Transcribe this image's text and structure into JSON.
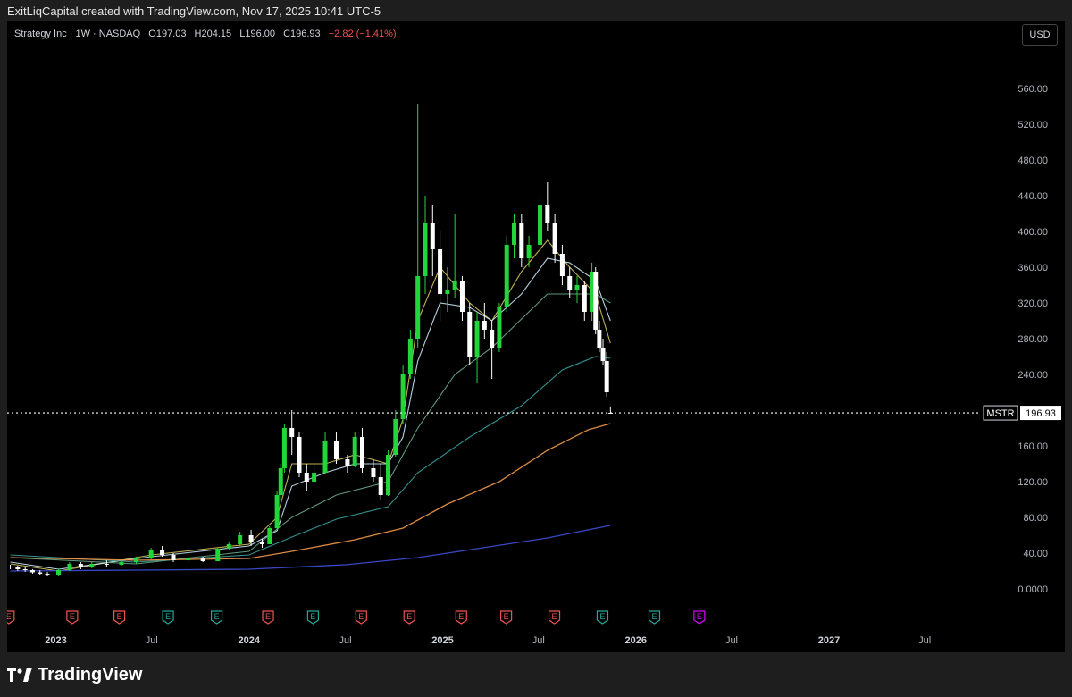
{
  "header": {
    "attribution": "ExitLiqCapital created with TradingView.com, Nov 17, 2025 10:41 UTC-5"
  },
  "legend": {
    "symbol_desc": "Strategy Inc · 1W · NASDAQ",
    "o_label": "O",
    "o_value": "197.03",
    "h_label": "H",
    "h_value": "204.15",
    "l_label": "L",
    "l_value": "196.00",
    "c_label": "C",
    "c_value": "196.93",
    "change": "−2.82 (−1.41%)"
  },
  "currency_button": "USD",
  "price_tag": {
    "ticker": "MSTR",
    "value": "196.93"
  },
  "footer": {
    "brand": "TradingView"
  },
  "colors": {
    "up": "#22d63a",
    "down": "#ffffff",
    "grid": "#000000",
    "ma_fast": "#d4c35c",
    "ma_fast2": "#c9e6f5",
    "ma_mid": "#6aa88a",
    "ma_teal": "#3aa1a0",
    "ma_orange": "#f29a4a",
    "ma_blue": "#3f4fd9",
    "earnings_red": "#ef5350",
    "earnings_green": "#26a69a",
    "earnings_future": "#d500f9"
  },
  "chart_data": {
    "type": "candlestick",
    "title": "Strategy Inc · 1W · NASDAQ",
    "x_ticks": [
      "2023",
      "Jul",
      "2024",
      "Jul",
      "2025",
      "Jul",
      "2026",
      "Jul",
      "2027",
      "Jul"
    ],
    "x_tick_dates": [
      "2023-01-01",
      "2023-07-01",
      "2024-01-01",
      "2024-07-01",
      "2025-01-01",
      "2025-07-01",
      "2026-01-01",
      "2026-07-01",
      "2027-01-01",
      "2027-07-01"
    ],
    "x_range": [
      "2022-10-01",
      "2027-10-15"
    ],
    "y_ticks": [
      "0.0000",
      "40.00",
      "80.00",
      "120.00",
      "160.00",
      "240.00",
      "280.00",
      "320.00",
      "360.00",
      "400.00",
      "440.00",
      "480.00",
      "520.00",
      "560.00"
    ],
    "ylim": [
      -15,
      595
    ],
    "last_close": 196.93,
    "candles": [
      {
        "t": "2022-10-07",
        "o": 25.0,
        "h": 27.0,
        "l": 22.0,
        "c": 24.0
      },
      {
        "t": "2022-10-21",
        "o": 24.0,
        "h": 26.0,
        "l": 20.0,
        "c": 22.0
      },
      {
        "t": "2022-11-04",
        "o": 22.0,
        "h": 24.0,
        "l": 19.0,
        "c": 21.0
      },
      {
        "t": "2022-11-18",
        "o": 21.0,
        "h": 22.0,
        "l": 17.0,
        "c": 18.5
      },
      {
        "t": "2022-12-02",
        "o": 18.5,
        "h": 21.0,
        "l": 16.0,
        "c": 17.0
      },
      {
        "t": "2022-12-16",
        "o": 17.0,
        "h": 19.0,
        "l": 14.0,
        "c": 15.0
      },
      {
        "t": "2023-01-06",
        "o": 15.0,
        "h": 22.0,
        "l": 14.0,
        "c": 21.0
      },
      {
        "t": "2023-01-27",
        "o": 21.0,
        "h": 30.0,
        "l": 20.0,
        "c": 28.0
      },
      {
        "t": "2023-02-17",
        "o": 28.0,
        "h": 30.0,
        "l": 22.0,
        "c": 24.0
      },
      {
        "t": "2023-03-10",
        "o": 24.0,
        "h": 30.0,
        "l": 23.0,
        "c": 28.0
      },
      {
        "t": "2023-04-07",
        "o": 28.0,
        "h": 32.0,
        "l": 25.0,
        "c": 27.0
      },
      {
        "t": "2023-05-05",
        "o": 27.0,
        "h": 32.0,
        "l": 26.0,
        "c": 30.0
      },
      {
        "t": "2023-06-02",
        "o": 30.0,
        "h": 36.0,
        "l": 28.0,
        "c": 34.0
      },
      {
        "t": "2023-06-30",
        "o": 34.0,
        "h": 46.0,
        "l": 33.0,
        "c": 44.0
      },
      {
        "t": "2023-07-21",
        "o": 44.0,
        "h": 48.0,
        "l": 36.0,
        "c": 38.0
      },
      {
        "t": "2023-08-11",
        "o": 38.0,
        "h": 40.0,
        "l": 30.0,
        "c": 32.0
      },
      {
        "t": "2023-09-08",
        "o": 32.0,
        "h": 36.0,
        "l": 30.0,
        "c": 34.0
      },
      {
        "t": "2023-10-06",
        "o": 34.0,
        "h": 36.0,
        "l": 30.0,
        "c": 31.0
      },
      {
        "t": "2023-11-03",
        "o": 31.0,
        "h": 46.0,
        "l": 31.0,
        "c": 45.0
      },
      {
        "t": "2023-11-24",
        "o": 45.0,
        "h": 52.0,
        "l": 44.0,
        "c": 50.0
      },
      {
        "t": "2023-12-15",
        "o": 50.0,
        "h": 64.0,
        "l": 48.0,
        "c": 60.0
      },
      {
        "t": "2024-01-05",
        "o": 60.0,
        "h": 66.0,
        "l": 48.0,
        "c": 52.0
      },
      {
        "t": "2024-01-26",
        "o": 52.0,
        "h": 56.0,
        "l": 46.0,
        "c": 50.0
      },
      {
        "t": "2024-02-09",
        "o": 50.0,
        "h": 70.0,
        "l": 50.0,
        "c": 68.0
      },
      {
        "t": "2024-02-23",
        "o": 68.0,
        "h": 110.0,
        "l": 66.0,
        "c": 105.0
      },
      {
        "t": "2024-03-01",
        "o": 105.0,
        "h": 140.0,
        "l": 100.0,
        "c": 135.0
      },
      {
        "t": "2024-03-08",
        "o": 135.0,
        "h": 185.0,
        "l": 130.0,
        "c": 180.0
      },
      {
        "t": "2024-03-22",
        "o": 180.0,
        "h": 200.0,
        "l": 150.0,
        "c": 170.0
      },
      {
        "t": "2024-04-05",
        "o": 170.0,
        "h": 175.0,
        "l": 125.0,
        "c": 130.0
      },
      {
        "t": "2024-04-19",
        "o": 130.0,
        "h": 140.0,
        "l": 110.0,
        "c": 120.0
      },
      {
        "t": "2024-05-03",
        "o": 120.0,
        "h": 140.0,
        "l": 118.0,
        "c": 130.0
      },
      {
        "t": "2024-05-24",
        "o": 130.0,
        "h": 175.0,
        "l": 128.0,
        "c": 165.0
      },
      {
        "t": "2024-06-14",
        "o": 165.0,
        "h": 175.0,
        "l": 140.0,
        "c": 145.0
      },
      {
        "t": "2024-07-05",
        "o": 145.0,
        "h": 150.0,
        "l": 130.0,
        "c": 138.0
      },
      {
        "t": "2024-07-19",
        "o": 138.0,
        "h": 175.0,
        "l": 136.0,
        "c": 170.0
      },
      {
        "t": "2024-08-02",
        "o": 170.0,
        "h": 180.0,
        "l": 130.0,
        "c": 135.0
      },
      {
        "t": "2024-08-23",
        "o": 135.0,
        "h": 145.0,
        "l": 120.0,
        "c": 125.0
      },
      {
        "t": "2024-09-06",
        "o": 125.0,
        "h": 140.0,
        "l": 100.0,
        "c": 105.0
      },
      {
        "t": "2024-09-20",
        "o": 105.0,
        "h": 155.0,
        "l": 104.0,
        "c": 150.0
      },
      {
        "t": "2024-10-04",
        "o": 150.0,
        "h": 200.0,
        "l": 148.0,
        "c": 190.0
      },
      {
        "t": "2024-10-18",
        "o": 190.0,
        "h": 250.0,
        "l": 185.0,
        "c": 240.0
      },
      {
        "t": "2024-11-01",
        "o": 240.0,
        "h": 290.0,
        "l": 235.0,
        "c": 280.0
      },
      {
        "t": "2024-11-15",
        "o": 280.0,
        "h": 543.0,
        "l": 270.0,
        "c": 350.0
      },
      {
        "t": "2024-11-29",
        "o": 350.0,
        "h": 440.0,
        "l": 330.0,
        "c": 410.0
      },
      {
        "t": "2024-12-13",
        "o": 410.0,
        "h": 430.0,
        "l": 350.0,
        "c": 380.0
      },
      {
        "t": "2024-12-27",
        "o": 380.0,
        "h": 400.0,
        "l": 300.0,
        "c": 330.0
      },
      {
        "t": "2025-01-10",
        "o": 330.0,
        "h": 360.0,
        "l": 310.0,
        "c": 335.0
      },
      {
        "t": "2025-01-24",
        "o": 335.0,
        "h": 420.0,
        "l": 325.0,
        "c": 345.0
      },
      {
        "t": "2025-02-07",
        "o": 345.0,
        "h": 350.0,
        "l": 300.0,
        "c": 310.0
      },
      {
        "t": "2025-02-21",
        "o": 310.0,
        "h": 320.0,
        "l": 250.0,
        "c": 260.0
      },
      {
        "t": "2025-03-07",
        "o": 260.0,
        "h": 310.0,
        "l": 230.0,
        "c": 300.0
      },
      {
        "t": "2025-03-21",
        "o": 300.0,
        "h": 320.0,
        "l": 280.0,
        "c": 290.0
      },
      {
        "t": "2025-04-04",
        "o": 290.0,
        "h": 300.0,
        "l": 235.0,
        "c": 270.0
      },
      {
        "t": "2025-04-18",
        "o": 270.0,
        "h": 320.0,
        "l": 265.0,
        "c": 315.0
      },
      {
        "t": "2025-05-02",
        "o": 315.0,
        "h": 395.0,
        "l": 310.0,
        "c": 385.0
      },
      {
        "t": "2025-05-16",
        "o": 385.0,
        "h": 420.0,
        "l": 370.0,
        "c": 410.0
      },
      {
        "t": "2025-05-30",
        "o": 410.0,
        "h": 420.0,
        "l": 360.0,
        "c": 370.0
      },
      {
        "t": "2025-06-13",
        "o": 370.0,
        "h": 395.0,
        "l": 360.0,
        "c": 385.0
      },
      {
        "t": "2025-07-04",
        "o": 385.0,
        "h": 440.0,
        "l": 380.0,
        "c": 430.0
      },
      {
        "t": "2025-07-18",
        "o": 430.0,
        "h": 455.0,
        "l": 400.0,
        "c": 410.0
      },
      {
        "t": "2025-08-01",
        "o": 410.0,
        "h": 420.0,
        "l": 365.0,
        "c": 375.0
      },
      {
        "t": "2025-08-15",
        "o": 375.0,
        "h": 385.0,
        "l": 340.0,
        "c": 350.0
      },
      {
        "t": "2025-08-29",
        "o": 350.0,
        "h": 360.0,
        "l": 325.0,
        "c": 335.0
      },
      {
        "t": "2025-09-12",
        "o": 335.0,
        "h": 350.0,
        "l": 320.0,
        "c": 340.0
      },
      {
        "t": "2025-09-26",
        "o": 340.0,
        "h": 345.0,
        "l": 300.0,
        "c": 310.0
      },
      {
        "t": "2025-10-10",
        "o": 310.0,
        "h": 365.0,
        "l": 300.0,
        "c": 355.0
      },
      {
        "t": "2025-10-17",
        "o": 355.0,
        "h": 360.0,
        "l": 285.0,
        "c": 290.0
      },
      {
        "t": "2025-10-24",
        "o": 290.0,
        "h": 300.0,
        "l": 265.0,
        "c": 270.0
      },
      {
        "t": "2025-10-31",
        "o": 270.0,
        "h": 280.0,
        "l": 250.0,
        "c": 255.0
      },
      {
        "t": "2025-11-07",
        "o": 255.0,
        "h": 265.0,
        "l": 215.0,
        "c": 220.0
      },
      {
        "t": "2025-11-14",
        "o": 197.03,
        "h": 204.15,
        "l": 196.0,
        "c": 196.93
      }
    ],
    "moving_averages": [
      {
        "role": "ma_fast",
        "points": [
          [
            "2022-10-07",
            28
          ],
          [
            "2023-01-06",
            20
          ],
          [
            "2023-07-01",
            38
          ],
          [
            "2024-01-01",
            50
          ],
          [
            "2024-02-23",
            80
          ],
          [
            "2024-03-22",
            140
          ],
          [
            "2024-05-24",
            140
          ],
          [
            "2024-07-19",
            150
          ],
          [
            "2024-09-20",
            140
          ],
          [
            "2024-10-18",
            190
          ],
          [
            "2024-11-15",
            300
          ],
          [
            "2024-12-27",
            360
          ],
          [
            "2025-02-21",
            320
          ],
          [
            "2025-04-04",
            300
          ],
          [
            "2025-05-30",
            355
          ],
          [
            "2025-07-18",
            390
          ],
          [
            "2025-08-29",
            360
          ],
          [
            "2025-10-17",
            330
          ],
          [
            "2025-11-14",
            275
          ]
        ]
      },
      {
        "role": "ma_fast2",
        "points": [
          [
            "2022-10-07",
            30
          ],
          [
            "2023-01-06",
            22
          ],
          [
            "2023-07-01",
            36
          ],
          [
            "2024-01-01",
            48
          ],
          [
            "2024-02-23",
            65
          ],
          [
            "2024-03-22",
            115
          ],
          [
            "2024-05-24",
            130
          ],
          [
            "2024-07-19",
            140
          ],
          [
            "2024-09-20",
            140
          ],
          [
            "2024-10-18",
            170
          ],
          [
            "2024-11-15",
            255
          ],
          [
            "2024-12-27",
            320
          ],
          [
            "2025-02-21",
            315
          ],
          [
            "2025-04-04",
            300
          ],
          [
            "2025-05-30",
            330
          ],
          [
            "2025-07-18",
            370
          ],
          [
            "2025-08-29",
            365
          ],
          [
            "2025-10-17",
            345
          ],
          [
            "2025-11-14",
            300
          ]
        ]
      },
      {
        "role": "ma_mid",
        "points": [
          [
            "2022-10-07",
            35
          ],
          [
            "2023-06-01",
            28
          ],
          [
            "2024-01-01",
            42
          ],
          [
            "2024-03-22",
            80
          ],
          [
            "2024-06-14",
            105
          ],
          [
            "2024-09-20",
            120
          ],
          [
            "2024-11-15",
            180
          ],
          [
            "2025-01-24",
            240
          ],
          [
            "2025-04-04",
            270
          ],
          [
            "2025-07-18",
            330
          ],
          [
            "2025-10-17",
            330
          ],
          [
            "2025-11-14",
            320
          ]
        ]
      },
      {
        "role": "ma_teal",
        "points": [
          [
            "2022-10-07",
            38
          ],
          [
            "2023-06-01",
            30
          ],
          [
            "2024-01-01",
            38
          ],
          [
            "2024-03-22",
            58
          ],
          [
            "2024-06-14",
            78
          ],
          [
            "2024-09-20",
            92
          ],
          [
            "2024-11-15",
            130
          ],
          [
            "2025-02-21",
            170
          ],
          [
            "2025-05-30",
            205
          ],
          [
            "2025-08-15",
            245
          ],
          [
            "2025-10-17",
            260
          ],
          [
            "2025-11-14",
            258
          ]
        ]
      },
      {
        "role": "ma_orange",
        "points": [
          [
            "2022-10-07",
            35
          ],
          [
            "2023-06-01",
            32
          ],
          [
            "2024-01-01",
            34
          ],
          [
            "2024-03-22",
            42
          ],
          [
            "2024-07-19",
            55
          ],
          [
            "2024-10-18",
            68
          ],
          [
            "2025-01-10",
            95
          ],
          [
            "2025-04-18",
            120
          ],
          [
            "2025-07-18",
            155
          ],
          [
            "2025-10-03",
            178
          ],
          [
            "2025-11-14",
            185
          ]
        ]
      },
      {
        "role": "ma_blue",
        "points": [
          [
            "2022-10-07",
            20
          ],
          [
            "2023-06-01",
            21
          ],
          [
            "2024-01-01",
            22
          ],
          [
            "2024-07-01",
            27
          ],
          [
            "2024-11-15",
            35
          ],
          [
            "2025-03-07",
            45
          ],
          [
            "2025-07-18",
            57
          ],
          [
            "2025-11-14",
            71
          ]
        ]
      }
    ],
    "earnings_markers": [
      {
        "t": "2022-10-04",
        "type": "red"
      },
      {
        "t": "2023-02-01",
        "type": "red"
      },
      {
        "t": "2023-05-01",
        "type": "red"
      },
      {
        "t": "2023-08-01",
        "type": "green"
      },
      {
        "t": "2023-11-01",
        "type": "green"
      },
      {
        "t": "2024-02-06",
        "type": "red"
      },
      {
        "t": "2024-05-01",
        "type": "green"
      },
      {
        "t": "2024-07-31",
        "type": "red"
      },
      {
        "t": "2024-10-30",
        "type": "red"
      },
      {
        "t": "2025-02-05",
        "type": "red"
      },
      {
        "t": "2025-05-01",
        "type": "red"
      },
      {
        "t": "2025-07-31",
        "type": "red"
      },
      {
        "t": "2025-10-30",
        "type": "green"
      },
      {
        "t": "2026-02-05",
        "type": "green"
      },
      {
        "t": "2026-05-01",
        "type": "future"
      }
    ]
  }
}
